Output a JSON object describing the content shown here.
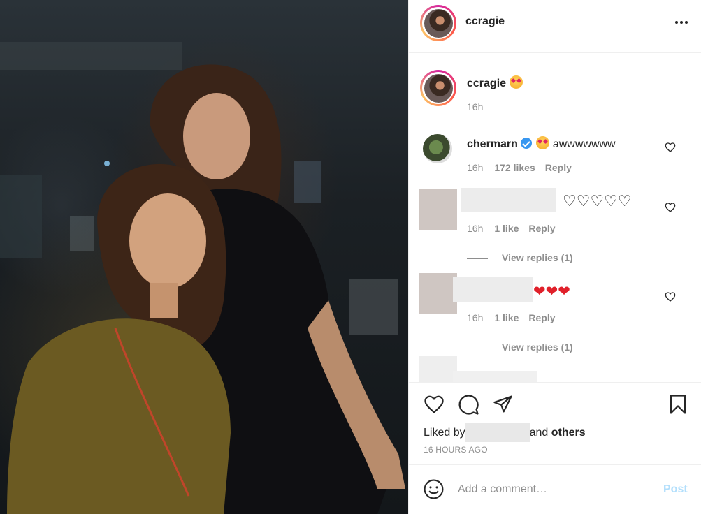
{
  "post": {
    "author": "ccragie",
    "more_icon": "more-horizontal-icon"
  },
  "caption": {
    "username": "ccragie",
    "emoji": "star-struck-emoji",
    "time": "16h"
  },
  "comments": [
    {
      "username": "chermarn",
      "verified": true,
      "text": "awwwwwww",
      "time": "16h",
      "likes": "172 likes",
      "reply": "Reply"
    },
    {
      "username_hidden": true,
      "text_hearts": "♡♡♡♡♡",
      "time": "16h",
      "likes": "1 like",
      "reply": "Reply",
      "view_replies": "View replies (1)"
    },
    {
      "username_hidden": true,
      "text_hearts": "❤❤❤",
      "time": "16h",
      "likes": "1 like",
      "reply": "Reply",
      "view_replies": "View replies (1)"
    }
  ],
  "actions": {
    "liked_by_prefix": "Liked by",
    "liked_by_suffix": "and",
    "others": "others",
    "timestamp": "16 HOURS AGO"
  },
  "add_comment": {
    "placeholder": "Add a comment…",
    "post_label": "Post"
  },
  "colors": {
    "text": "#262626",
    "muted": "#8e8e8e",
    "verified": "#3897f0",
    "post_disabled": "#b2dffc",
    "heart_red": "#e0202a"
  }
}
